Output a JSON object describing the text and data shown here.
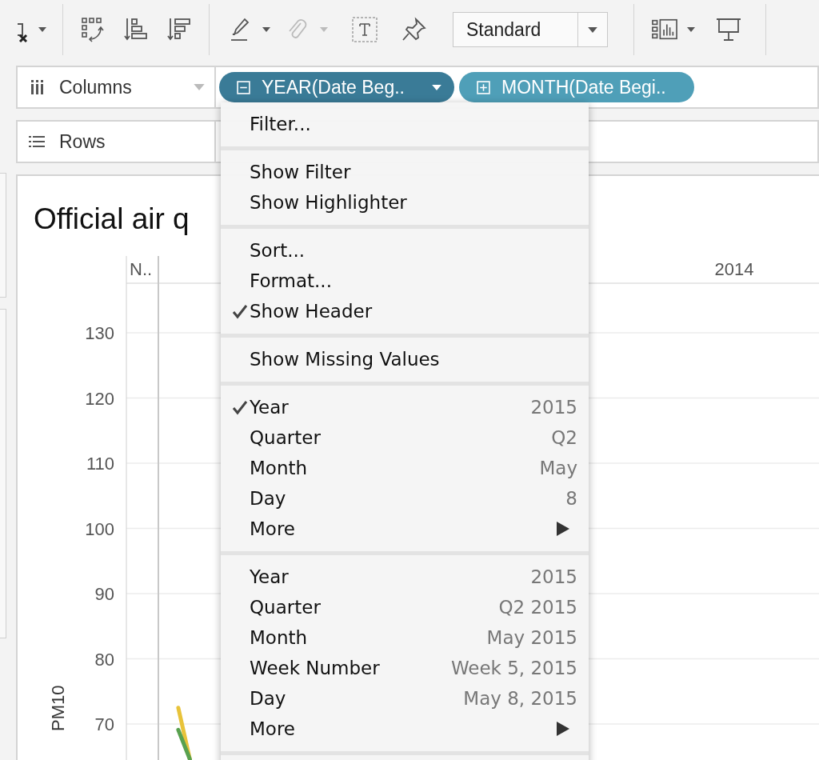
{
  "toolbar": {
    "view_dropdown": {
      "value": "Standard"
    }
  },
  "columns_shelf": {
    "label": "Columns",
    "pills": [
      {
        "label": "YEAR(Date Beg..",
        "expanded": true,
        "selected": true
      },
      {
        "label": "MONTH(Date Begi..",
        "expanded": false,
        "selected": false
      }
    ]
  },
  "rows_shelf": {
    "label": "Rows"
  },
  "worksheet": {
    "title": "Official air q",
    "headers": [
      "N..",
      "2014"
    ],
    "chart_data": {
      "type": "line",
      "ylabel": "PM10",
      "ylim": [
        64.5,
        137.5
      ],
      "grid": true,
      "yticks": [
        70,
        80,
        90,
        100,
        110,
        120,
        130
      ],
      "categories": [
        null,
        null,
        null,
        null,
        null,
        null,
        null,
        null,
        null,
        null,
        null,
        null,
        null,
        null,
        null,
        null,
        null,
        null,
        null,
        null,
        null,
        null,
        null,
        null,
        null,
        null,
        null,
        null,
        null,
        null,
        null,
        null,
        null,
        null,
        null,
        null,
        null,
        null,
        null,
        null,
        null,
        null,
        null,
        null,
        null,
        null,
        null,
        null,
        null,
        null,
        null,
        null,
        null,
        null,
        null,
        null,
        null,
        null,
        null,
        null
      ],
      "series": [
        {
          "color": "#e8c33a",
          "values": [
            null,
            null,
            null,
            null,
            72.5,
            64.6,
            null,
            null,
            null,
            null,
            null,
            null,
            null,
            null,
            null,
            null,
            null,
            null,
            null,
            null,
            null,
            null,
            null,
            null,
            null,
            null,
            null,
            null,
            null,
            null,
            null,
            null,
            null,
            null,
            null,
            null,
            null,
            null,
            null,
            null,
            null,
            null,
            null,
            null,
            null,
            null,
            null,
            null,
            null,
            null,
            null,
            null,
            null,
            null,
            null,
            null,
            null,
            null,
            null,
            null
          ]
        },
        {
          "color": "#59a14f",
          "values": [
            null,
            null,
            null,
            null,
            69.1,
            64.6,
            null,
            null,
            null,
            null,
            null,
            null,
            null,
            null,
            null,
            null,
            null,
            null,
            null,
            null,
            null,
            null,
            null,
            null,
            null,
            null,
            null,
            null,
            null,
            null,
            null,
            null,
            null,
            null,
            null,
            null,
            null,
            null,
            null,
            null,
            null,
            null,
            null,
            null,
            null,
            null,
            null,
            null,
            null,
            null,
            null,
            null,
            null,
            null,
            null,
            null,
            null,
            null,
            null,
            null
          ]
        }
      ]
    }
  },
  "menu": {
    "groups": [
      {
        "items": [
          {
            "kind": "item",
            "label": "Filter...",
            "checked": false
          }
        ]
      },
      {
        "items": [
          {
            "kind": "item",
            "label": "Show Filter",
            "checked": false
          },
          {
            "kind": "item",
            "label": "Show Highlighter",
            "checked": false
          }
        ]
      },
      {
        "items": [
          {
            "kind": "item",
            "label": "Sort...",
            "checked": false
          },
          {
            "kind": "item",
            "label": "Format...",
            "checked": false
          },
          {
            "kind": "item",
            "label": "Show Header",
            "checked": true
          }
        ]
      },
      {
        "items": [
          {
            "kind": "item",
            "label": "Show Missing Values",
            "checked": false
          }
        ]
      },
      {
        "items": [
          {
            "kind": "item",
            "label": "Year",
            "value": "2015",
            "checked": true
          },
          {
            "kind": "item",
            "label": "Quarter",
            "value": "Q2",
            "checked": false
          },
          {
            "kind": "item",
            "label": "Month",
            "value": "May",
            "checked": false
          },
          {
            "kind": "item",
            "label": "Day",
            "value": "8",
            "checked": false
          },
          {
            "kind": "submenu",
            "label": "More",
            "checked": false
          }
        ]
      },
      {
        "items": [
          {
            "kind": "item",
            "label": "Year",
            "value": "2015",
            "checked": false
          },
          {
            "kind": "item",
            "label": "Quarter",
            "value": "Q2 2015",
            "checked": false
          },
          {
            "kind": "item",
            "label": "Month",
            "value": "May 2015",
            "checked": false
          },
          {
            "kind": "item",
            "label": "Week Number",
            "value": "Week 5, 2015",
            "checked": false
          },
          {
            "kind": "item",
            "label": "Day",
            "value": "May 8, 2015",
            "checked": false
          },
          {
            "kind": "submenu",
            "label": "More",
            "checked": false
          }
        ]
      }
    ]
  }
}
